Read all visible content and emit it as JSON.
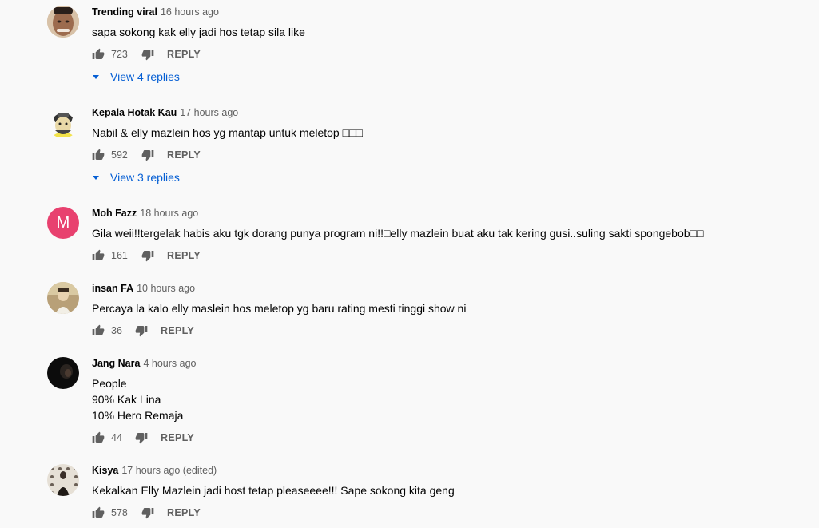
{
  "comments": [
    {
      "author": "Trending viral",
      "time": "16 hours ago",
      "text": "sapa sokong kak elly jadi hos tetap sila like",
      "likes": "723",
      "reply_label": "REPLY",
      "view_replies": "View 4 replies",
      "avatar": "man-face-photo"
    },
    {
      "author": "Kepala Hotak Kau",
      "time": "17 hours ago",
      "text": "Nabil & elly mazlein hos yg mantap untuk meletop □□□",
      "likes": "592",
      "reply_label": "REPLY",
      "view_replies": "View 3 replies",
      "avatar": "cartoon-character"
    },
    {
      "author": "Moh Fazz",
      "time": "18 hours ago",
      "text": "Gila weii!!tergelak habis aku tgk dorang punya program ni!!□elly mazlein buat aku tak kering gusi..suling sakti spongebob□□",
      "likes": "161",
      "reply_label": "REPLY",
      "avatar_letter": "M",
      "avatar_color": "#e8416f"
    },
    {
      "author": "insan FA",
      "time": "10 hours ago",
      "text": "Percaya la kalo elly maslein hos meletop yg baru rating mesti tinggi show ni",
      "likes": "36",
      "reply_label": "REPLY",
      "avatar": "person-photo"
    },
    {
      "author": "Jang Nara",
      "time": "4 hours ago",
      "text": "People\n90% Kak Lina\n10% Hero Remaja",
      "likes": "44",
      "reply_label": "REPLY",
      "avatar": "dark-photo"
    },
    {
      "author": "Kisya",
      "time": "17 hours ago (edited)",
      "text": "Kekalkan Elly Mazlein jadi host tetap pleaseeee!!! Sape sokong kita geng",
      "likes": "578",
      "reply_label": "REPLY",
      "avatar": "pattern-photo"
    }
  ],
  "colors": {
    "background": "#f9f9f9",
    "link": "#065fd4",
    "secondary": "#606060"
  }
}
